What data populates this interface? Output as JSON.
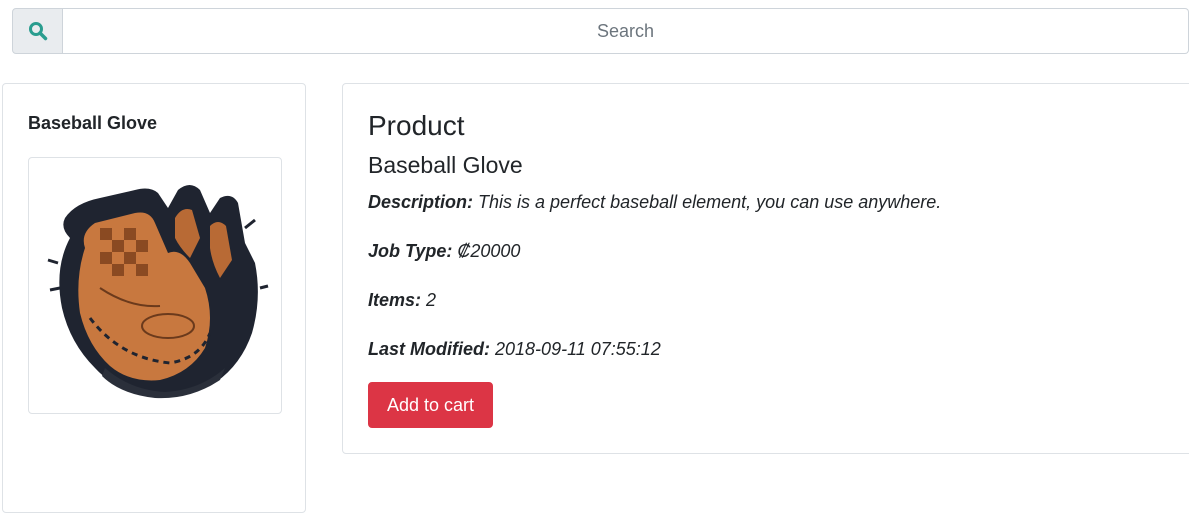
{
  "search": {
    "placeholder": "Search",
    "icon": "search-icon",
    "icon_color": "#2a9d8f"
  },
  "sidebar": {
    "title": "Baseball Glove",
    "image_alt": "baseball-glove-image"
  },
  "product": {
    "heading": "Product",
    "name": "Baseball Glove",
    "description_label": "Description:",
    "description_value": "This is a perfect baseball element, you can use anywhere.",
    "job_type_label": "Job Type:",
    "job_type_value": "₡20000",
    "items_label": "Items:",
    "items_value": "2",
    "last_modified_label": "Last Modified:",
    "last_modified_value": "2018-09-11 07:55:12",
    "cart_button_label": "Add to cart"
  },
  "colors": {
    "accent_danger": "#dc3545",
    "border": "#dee2e6",
    "glove_leather": "#c8783f",
    "glove_black": "#1f2430"
  }
}
